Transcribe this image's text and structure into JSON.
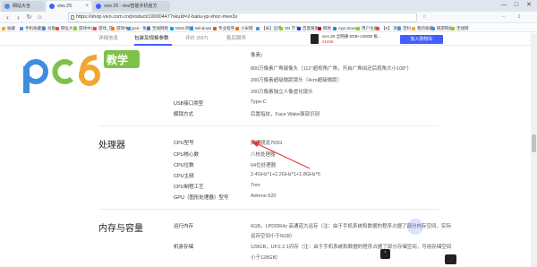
{
  "browser": {
    "tabs": [
      {
        "label": "网站大全",
        "active": false,
        "color": "#4a90e2"
      },
      {
        "label": "vivo Z5",
        "active": true,
        "color": "#415fff"
      },
      {
        "label": "vivo Z5 - vivo智能手机官方",
        "active": false,
        "color": "#415fff"
      }
    ],
    "window_controls": [
      "—",
      "□",
      "✕"
    ],
    "nav": {
      "back": "‹",
      "forward": "›",
      "refresh": "↻",
      "home": "⌂"
    },
    "url": "https://shop.vivo.com.cn/product/10000447?skuId=2-bailu-yp-shoc-mee3x",
    "extensions": [
      "☆",
      "⋯",
      "⇩"
    ],
    "bookmarks": [
      {
        "label": "收藏",
        "color": "#f5a623"
      },
      {
        "label": "手机收藏夹",
        "color": "#4a90e2"
      },
      {
        "label": "谷歌",
        "color": "#4285f4"
      },
      {
        "label": "网址大全",
        "color": "#e94e3c"
      },
      {
        "label": "游戏中心",
        "color": "#7ed321"
      },
      {
        "label": "游戏_在",
        "color": "#e94e3c"
      },
      {
        "label": "游戏中心",
        "color": "#ff6f00"
      },
      {
        "label": "pc6 - 免费",
        "color": "#4a90e2"
      },
      {
        "label": "无线网络",
        "color": "#3b78e7"
      },
      {
        "label": "MSN 网络",
        "color": "#00a1f1"
      },
      {
        "label": "Windows",
        "color": "#00a1f1"
      },
      {
        "label": "专业程序",
        "color": "#e94e3c"
      },
      {
        "label": "小米网",
        "color": "#ff6700"
      },
      {
        "label": "【米】应用",
        "color": "#4a90e2"
      },
      {
        "label": "SN 学习",
        "color": "#7ed321"
      },
      {
        "label": "百度搜索",
        "color": "#2932e1"
      },
      {
        "label": "网易",
        "color": "#d0021b"
      },
      {
        "label": "App Store",
        "color": "#1e88e5"
      },
      {
        "label": "用户注册",
        "color": "#7ed321"
      },
      {
        "label": "【K】 演练",
        "color": "#e94e3c"
      },
      {
        "label": "百科",
        "color": "#4a90e2"
      },
      {
        "label": "我的收藏",
        "color": "#f5a623"
      },
      {
        "label": "网游网站",
        "color": "#4a90e2"
      },
      {
        "label": "无线网",
        "color": "#7ed321"
      }
    ]
  },
  "subnav": {
    "tabs": [
      "详细信息",
      "包装及规格参数",
      "评价 (597)",
      "售后服务"
    ],
    "active_index": 1,
    "product_name": "vivo Z5 全网通 6GB+128GB 极...",
    "product_price": "¥1698",
    "buy_label": "加入购物车",
    "accent": "#415fff"
  },
  "logo": {
    "brand": "pc6",
    "sub": "教学",
    "colors": [
      "#3d8de0",
      "#7ec24a",
      "#f2a530"
    ]
  },
  "camera_rows": [
    {
      "label": "",
      "value": "像素)"
    },
    {
      "label": "",
      "value": "800万像素广角摄像头（112°超视角广角，开启广角拍还后视角大小108°）"
    },
    {
      "label": "",
      "value": "200万像素超级微距镜头（4cm超级微距）"
    },
    {
      "label": "",
      "value": "200万像素独立人像虚化镜头"
    }
  ],
  "misc_rows": [
    {
      "label": "USB接口类型",
      "value": "Type-C"
    },
    {
      "label": "解锁方式",
      "value": "后置指纹，Face Wake面部识别"
    }
  ],
  "processor": {
    "title": "处理器",
    "rows": [
      {
        "label": "CPU型号",
        "value": "高通骁龙765G"
      },
      {
        "label": "CPU核心数",
        "value": "八核处理器"
      },
      {
        "label": "CPU位数",
        "value": "64位处理器"
      },
      {
        "label": "CPU主频",
        "value": "2.4GHz*1+2.2GHz*1+1.8GHz*6"
      },
      {
        "label": "CPU制程工艺",
        "value": "7nm"
      },
      {
        "label": "GPU（图形处理器）型号",
        "value": "Adreno 620"
      }
    ]
  },
  "memory": {
    "title": "内存与容量",
    "rows": [
      {
        "label": "运行内存",
        "value": "6GB，LPDDR4x 高通道大运存（注：由于手机系统和数据的程序占据了部分内存空间，实际",
        "value2": "运存空间小于6GB）"
      },
      {
        "label": "机身存储",
        "value": "128GB，UFS 2.1闪存（注：由于手机系统和数据的程序占据了部分存储空间，可用存储空间",
        "value2": "小于128GB）"
      }
    ]
  },
  "annotation": {
    "color": "#e53935"
  },
  "float": {
    "top_label": "⌃"
  }
}
